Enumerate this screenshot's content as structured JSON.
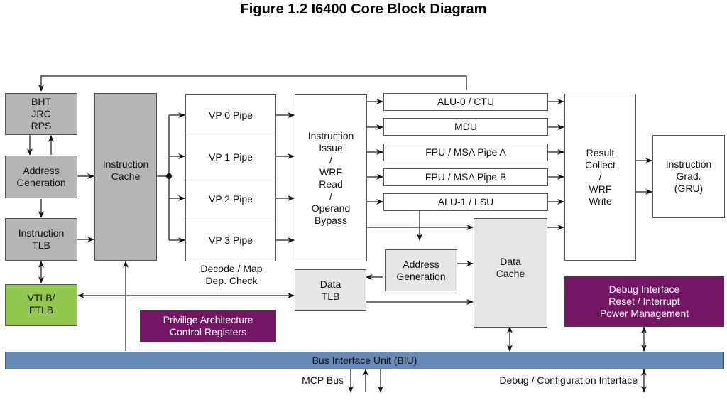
{
  "title": "Figure 1.2  I6400 Core Block Diagram",
  "colors": {
    "gray_block": "#b5b5b5",
    "light_gray_block": "#e6e6e6",
    "green_block": "#92c84f",
    "purple_block": "#731764",
    "bus_blue": "#6789b5"
  },
  "blocks": {
    "bht": "BHT\nJRC\nRPS",
    "addr_gen_i": "Address\nGeneration",
    "itlb": "Instruction\nTLB",
    "icache": "Instruction\nCache",
    "vp0": "VP 0 Pipe",
    "vp1": "VP 1 Pipe",
    "vp2": "VP 2 Pipe",
    "vp3": "VP 3 Pipe",
    "issue": "Instruction\nIssue\n/\nWRF\nRead\n/\nOperand\nBypass",
    "alu0": "ALU-0 / CTU",
    "mdu": "MDU",
    "fpu_a": "FPU / MSA Pipe A",
    "fpu_b": "FPU / MSA Pipe B",
    "alu1": "ALU-1 / LSU",
    "result": "Result\nCollect\n/\nWRF\nWrite",
    "grad": "Instruction\nGrad.\n(GRU)",
    "addr_gen_d": "Address\nGeneration",
    "dcache": "Data\nCache",
    "dtlb": "Data\nTLB",
    "vtlb": "VTLB/\nFTLB",
    "priv": "Privilige Architecture\nControl Registers",
    "debug": "Debug Interface\nReset / Interrupt\nPower Management",
    "biu": "Bus Interface Unit (BIU)"
  },
  "labels": {
    "decode": "Decode / Map\nDep. Check",
    "mcp_bus": "MCP Bus",
    "debug_cfg": "Debug / Configuration Interface"
  }
}
